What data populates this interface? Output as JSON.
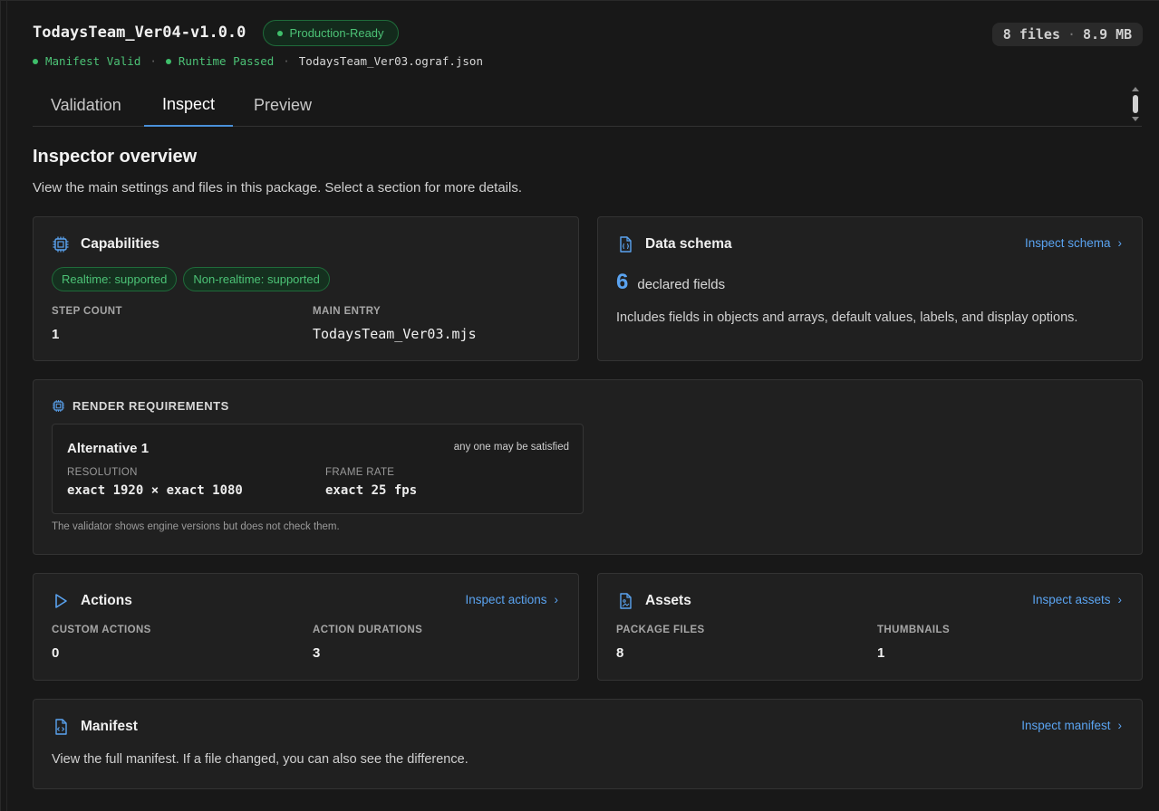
{
  "header": {
    "title": "TodaysTeam_Ver04-v1.0.0",
    "badge": "Production-Ready",
    "files": "8 files",
    "size": "8.9 MB",
    "status": {
      "manifest": "Manifest Valid",
      "runtime": "Runtime Passed",
      "file": "TodaysTeam_Ver03.ograf.json"
    }
  },
  "tabs": [
    {
      "label": "Validation"
    },
    {
      "label": "Inspect"
    },
    {
      "label": "Preview"
    }
  ],
  "overview": {
    "title": "Inspector overview",
    "subtitle": "View the main settings and files in this package. Select a section for more details."
  },
  "capabilities": {
    "title": "Capabilities",
    "pills": [
      "Realtime: supported",
      "Non-realtime: supported"
    ],
    "step_label": "STEP COUNT",
    "step_value": "1",
    "entry_label": "MAIN ENTRY",
    "entry_value": "TodaysTeam_Ver03.mjs"
  },
  "schema": {
    "title": "Data schema",
    "link": "Inspect schema",
    "count": "6",
    "count_label": "declared fields",
    "description": "Includes fields in objects and arrays, default values, labels, and display options."
  },
  "render": {
    "title": "RENDER REQUIREMENTS",
    "alt_title": "Alternative 1",
    "alt_note": "any one may be satisfied",
    "res_label": "RESOLUTION",
    "res_value": "exact 1920 × exact 1080",
    "fps_label": "FRAME RATE",
    "fps_value": "exact 25 fps",
    "footnote": "The validator shows engine versions but does not check them."
  },
  "actions": {
    "title": "Actions",
    "link": "Inspect actions",
    "custom_label": "CUSTOM ACTIONS",
    "custom_value": "0",
    "dur_label": "ACTION DURATIONS",
    "dur_value": "3"
  },
  "assets": {
    "title": "Assets",
    "link": "Inspect assets",
    "files_label": "PACKAGE FILES",
    "files_value": "8",
    "thumbs_label": "THUMBNAILS",
    "thumbs_value": "1"
  },
  "manifest": {
    "title": "Manifest",
    "link": "Inspect manifest",
    "description": "View the full manifest. If a file changed, you can also see the difference."
  },
  "colors": {
    "background": "#181818",
    "card": "#202020",
    "accent": "#4a90d9",
    "link": "#5aa3f0",
    "success": "#4cc276"
  }
}
